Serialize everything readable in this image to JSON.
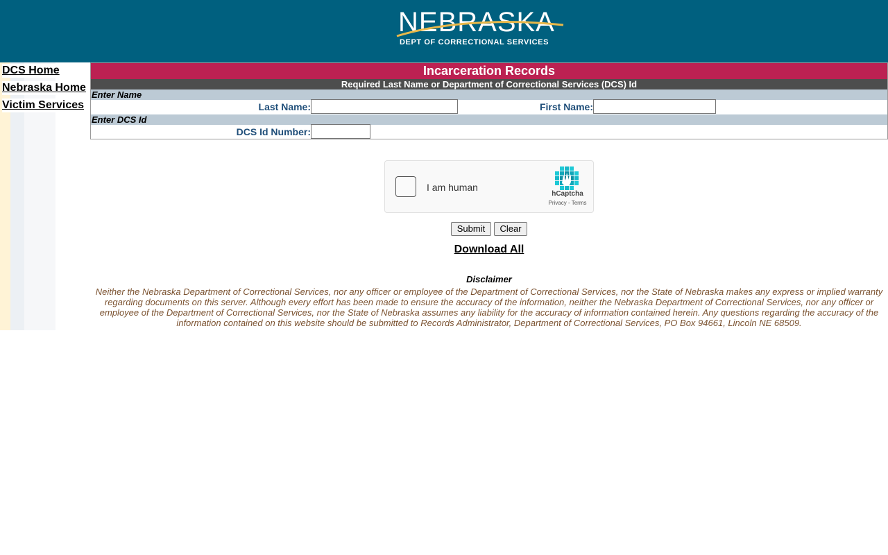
{
  "header": {
    "logo_word": "NEBRASKA",
    "logo_subtitle": "DEPT OF CORRECTIONAL SERVICES",
    "bg_color": "#00607f",
    "swoosh_color": "#e8b84a"
  },
  "sidebar": {
    "links": [
      {
        "label": "DCS Home"
      },
      {
        "label": "Nebraska Home"
      },
      {
        "label": "Victim Services"
      }
    ]
  },
  "form": {
    "title": "Incarceration Records",
    "subtitle": "Required Last Name or Department of Correctional Services (DCS) Id",
    "section_name": "Enter Name",
    "last_name_label": "Last Name:",
    "last_name_value": "",
    "first_name_label": "First Name:",
    "first_name_value": "",
    "section_id": "Enter DCS Id",
    "dcs_id_label": "DCS Id Number:",
    "dcs_id_value": "",
    "title_color": "#bc2152",
    "subtitle_color": "#4d4d4d",
    "section_color": "#bccad5"
  },
  "captcha": {
    "label": "I am human",
    "brand": "hCaptcha",
    "links": "Privacy - Terms"
  },
  "actions": {
    "submit_label": "Submit",
    "clear_label": "Clear",
    "download_label": "Download All"
  },
  "disclaimer": {
    "title": "Disclaimer",
    "body": "Neither the Nebraska Department of Correctional Services, nor any officer or employee of the Department of Correctional Services, nor the State of Nebraska makes any express or implied warranty regarding documents on this server. Although every effort has been made to ensure the accuracy of the information, neither the Nebraska Department of Correctional Services, nor any officer or employee of the Department of Correctional Services, nor the State of Nebraska assumes any liability for the accuracy of information contained herein. Any questions regarding the accuracy of the information contained on this website should be submitted to Records Administrator, Department of Correctional Services, PO Box 94661, Lincoln NE 68509."
  }
}
